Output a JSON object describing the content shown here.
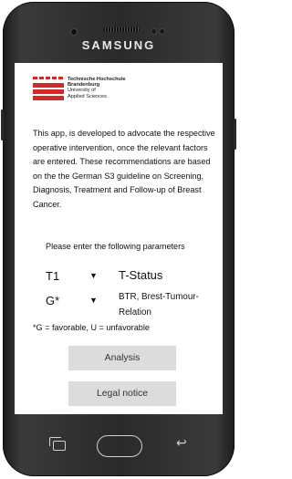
{
  "device": {
    "brand": "SAMSUNG"
  },
  "logo": {
    "line1": "Technische Hochschule",
    "line2": "Brandenburg",
    "line3": "University of",
    "line4": "Applied Sciences"
  },
  "intro_text": "This app, is developed to advocate the respective operative intervention, once the relevant factors are entered. These recommendations are based on the the German S3 guideline on Screening, Diagnosis, Treatment and Follow-up of Breast Cancer.",
  "params_prompt": "Please enter the following parameters",
  "params": [
    {
      "value": "T1",
      "description": "T-Status"
    },
    {
      "value": "G*",
      "description": "BTR, Brest-Tumour-Relation"
    }
  ],
  "note": "*G = favorable, U = unfavorable",
  "buttons": {
    "analysis": "Analysis",
    "legal": "Legal notice"
  },
  "icons": {
    "dropdown": "▼",
    "back": "↩"
  }
}
